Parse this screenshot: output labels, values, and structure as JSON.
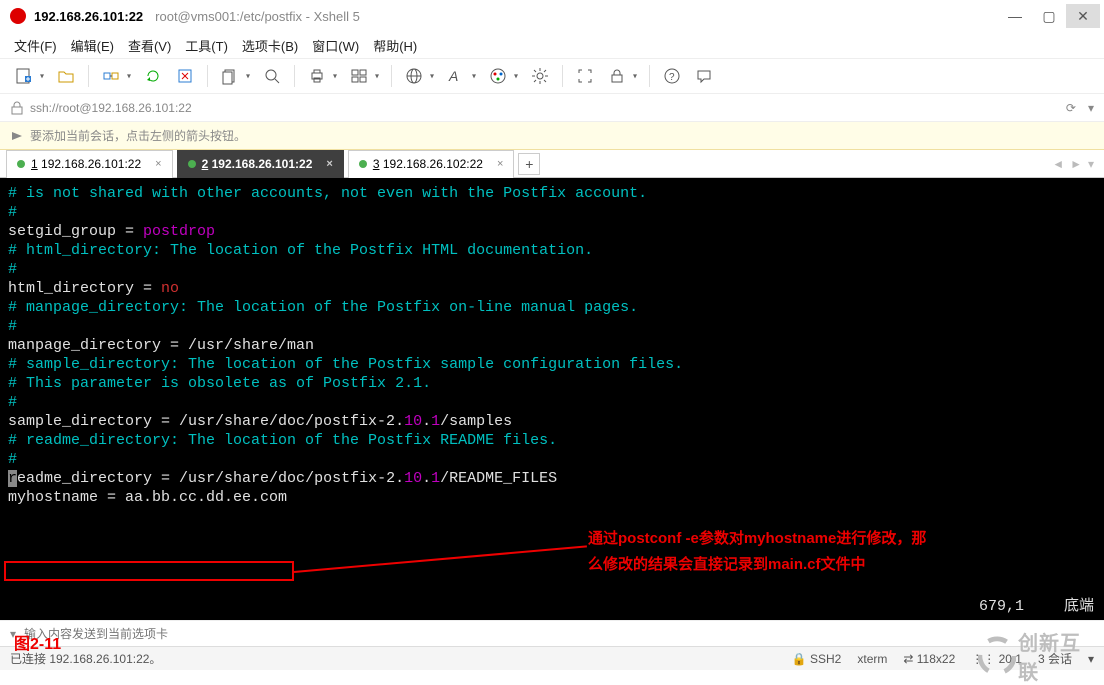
{
  "window": {
    "address": "192.168.26.101:22",
    "subtitle": "root@vms001:/etc/postfix - Xshell 5"
  },
  "menu": {
    "file": "文件(F)",
    "edit": "编辑(E)",
    "view": "查看(V)",
    "tools": "工具(T)",
    "tabs": "选项卡(B)",
    "window": "窗口(W)",
    "help": "帮助(H)"
  },
  "icons": {
    "newfile": "newfile",
    "open": "open",
    "link": "link",
    "reconnect": "reconnect",
    "paste": "paste",
    "search": "search",
    "print": "print",
    "layout": "layout",
    "globe": "globe",
    "font": "font",
    "palette": "palette",
    "cog": "cog",
    "fullscreen": "fullscreen",
    "lockt": "lock",
    "help": "help",
    "bubble": "bubble"
  },
  "addr": {
    "url": "ssh://root@192.168.26.101:22"
  },
  "hint": {
    "text": "要添加当前会话，点击左侧的箭头按钮。"
  },
  "tabs": {
    "t1": "192.168.26.101:22",
    "t1u": "1",
    "t2": "192.168.26.101:22",
    "t2u": "2",
    "t3": "192.168.26.102:22",
    "t3u": "3"
  },
  "term": {
    "l1": "# is not shared with other accounts, not even with the Postfix account.",
    "l2": "#",
    "l3a": "setgid_group = ",
    "l3b": "postdrop",
    "l4": "",
    "l5": "# html_directory: The location of the Postfix HTML documentation.",
    "l6": "#",
    "l7a": "html_directory = ",
    "l7b": "no",
    "l8": "",
    "l9": "# manpage_directory: The location of the Postfix on-line manual pages.",
    "l10": "#",
    "l11": "manpage_directory = /usr/share/man",
    "l12": "",
    "l13": "# sample_directory: The location of the Postfix sample configuration files.",
    "l14": "# This parameter is obsolete as of Postfix 2.1.",
    "l15": "#",
    "l16a": "sample_directory = /usr/share/doc/postfix-2.",
    "l16b": "10",
    "l16c": ".",
    "l16d": "1",
    "l16e": "/samples",
    "l17": "",
    "l18": "# readme_directory: The location of the Postfix README files.",
    "l19": "#",
    "l20a": "r",
    "l20b": "eadme_directory = /usr/share/doc/postfix-2.",
    "l20c": "10",
    "l20d": ".",
    "l20e": "1",
    "l20f": "/README_FILES",
    "l21": "myhostname = aa.bb.cc.dd.ee.com",
    "annot1": "通过postconf -e参数对myhostname进行修改，那",
    "annot2": "么修改的结果会直接记录到main.cf文件中",
    "pos": "679,1",
    "bot": "底端"
  },
  "inputbar": {
    "placeholder": "输入内容发送到当前选项卡"
  },
  "status": {
    "left": "已连接 192.168.26.101:22。",
    "ssh": "SSH2",
    "term": "xterm",
    "size": "118x22",
    "rc": "20,1",
    "sess": "3 会话",
    "si": "⇄"
  },
  "fig": "图2-11",
  "watermark": "创新互联"
}
